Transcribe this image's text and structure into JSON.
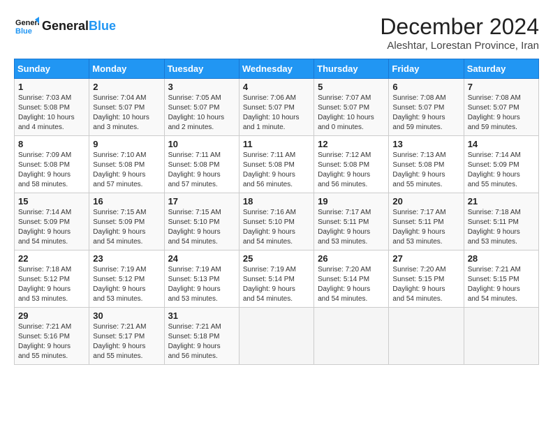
{
  "header": {
    "logo_line1": "General",
    "logo_line2": "Blue",
    "title": "December 2024",
    "subtitle": "Aleshtar, Lorestan Province, Iran"
  },
  "days_of_week": [
    "Sunday",
    "Monday",
    "Tuesday",
    "Wednesday",
    "Thursday",
    "Friday",
    "Saturday"
  ],
  "weeks": [
    [
      {
        "day": "1",
        "info": "Sunrise: 7:03 AM\nSunset: 5:08 PM\nDaylight: 10 hours\nand 4 minutes."
      },
      {
        "day": "2",
        "info": "Sunrise: 7:04 AM\nSunset: 5:07 PM\nDaylight: 10 hours\nand 3 minutes."
      },
      {
        "day": "3",
        "info": "Sunrise: 7:05 AM\nSunset: 5:07 PM\nDaylight: 10 hours\nand 2 minutes."
      },
      {
        "day": "4",
        "info": "Sunrise: 7:06 AM\nSunset: 5:07 PM\nDaylight: 10 hours\nand 1 minute."
      },
      {
        "day": "5",
        "info": "Sunrise: 7:07 AM\nSunset: 5:07 PM\nDaylight: 10 hours\nand 0 minutes."
      },
      {
        "day": "6",
        "info": "Sunrise: 7:08 AM\nSunset: 5:07 PM\nDaylight: 9 hours\nand 59 minutes."
      },
      {
        "day": "7",
        "info": "Sunrise: 7:08 AM\nSunset: 5:07 PM\nDaylight: 9 hours\nand 59 minutes."
      }
    ],
    [
      {
        "day": "8",
        "info": "Sunrise: 7:09 AM\nSunset: 5:08 PM\nDaylight: 9 hours\nand 58 minutes."
      },
      {
        "day": "9",
        "info": "Sunrise: 7:10 AM\nSunset: 5:08 PM\nDaylight: 9 hours\nand 57 minutes."
      },
      {
        "day": "10",
        "info": "Sunrise: 7:11 AM\nSunset: 5:08 PM\nDaylight: 9 hours\nand 57 minutes."
      },
      {
        "day": "11",
        "info": "Sunrise: 7:11 AM\nSunset: 5:08 PM\nDaylight: 9 hours\nand 56 minutes."
      },
      {
        "day": "12",
        "info": "Sunrise: 7:12 AM\nSunset: 5:08 PM\nDaylight: 9 hours\nand 56 minutes."
      },
      {
        "day": "13",
        "info": "Sunrise: 7:13 AM\nSunset: 5:08 PM\nDaylight: 9 hours\nand 55 minutes."
      },
      {
        "day": "14",
        "info": "Sunrise: 7:14 AM\nSunset: 5:09 PM\nDaylight: 9 hours\nand 55 minutes."
      }
    ],
    [
      {
        "day": "15",
        "info": "Sunrise: 7:14 AM\nSunset: 5:09 PM\nDaylight: 9 hours\nand 54 minutes."
      },
      {
        "day": "16",
        "info": "Sunrise: 7:15 AM\nSunset: 5:09 PM\nDaylight: 9 hours\nand 54 minutes."
      },
      {
        "day": "17",
        "info": "Sunrise: 7:15 AM\nSunset: 5:10 PM\nDaylight: 9 hours\nand 54 minutes."
      },
      {
        "day": "18",
        "info": "Sunrise: 7:16 AM\nSunset: 5:10 PM\nDaylight: 9 hours\nand 54 minutes."
      },
      {
        "day": "19",
        "info": "Sunrise: 7:17 AM\nSunset: 5:11 PM\nDaylight: 9 hours\nand 53 minutes."
      },
      {
        "day": "20",
        "info": "Sunrise: 7:17 AM\nSunset: 5:11 PM\nDaylight: 9 hours\nand 53 minutes."
      },
      {
        "day": "21",
        "info": "Sunrise: 7:18 AM\nSunset: 5:11 PM\nDaylight: 9 hours\nand 53 minutes."
      }
    ],
    [
      {
        "day": "22",
        "info": "Sunrise: 7:18 AM\nSunset: 5:12 PM\nDaylight: 9 hours\nand 53 minutes."
      },
      {
        "day": "23",
        "info": "Sunrise: 7:19 AM\nSunset: 5:12 PM\nDaylight: 9 hours\nand 53 minutes."
      },
      {
        "day": "24",
        "info": "Sunrise: 7:19 AM\nSunset: 5:13 PM\nDaylight: 9 hours\nand 53 minutes."
      },
      {
        "day": "25",
        "info": "Sunrise: 7:19 AM\nSunset: 5:14 PM\nDaylight: 9 hours\nand 54 minutes."
      },
      {
        "day": "26",
        "info": "Sunrise: 7:20 AM\nSunset: 5:14 PM\nDaylight: 9 hours\nand 54 minutes."
      },
      {
        "day": "27",
        "info": "Sunrise: 7:20 AM\nSunset: 5:15 PM\nDaylight: 9 hours\nand 54 minutes."
      },
      {
        "day": "28",
        "info": "Sunrise: 7:21 AM\nSunset: 5:15 PM\nDaylight: 9 hours\nand 54 minutes."
      }
    ],
    [
      {
        "day": "29",
        "info": "Sunrise: 7:21 AM\nSunset: 5:16 PM\nDaylight: 9 hours\nand 55 minutes."
      },
      {
        "day": "30",
        "info": "Sunrise: 7:21 AM\nSunset: 5:17 PM\nDaylight: 9 hours\nand 55 minutes."
      },
      {
        "day": "31",
        "info": "Sunrise: 7:21 AM\nSunset: 5:18 PM\nDaylight: 9 hours\nand 56 minutes."
      },
      null,
      null,
      null,
      null
    ]
  ]
}
